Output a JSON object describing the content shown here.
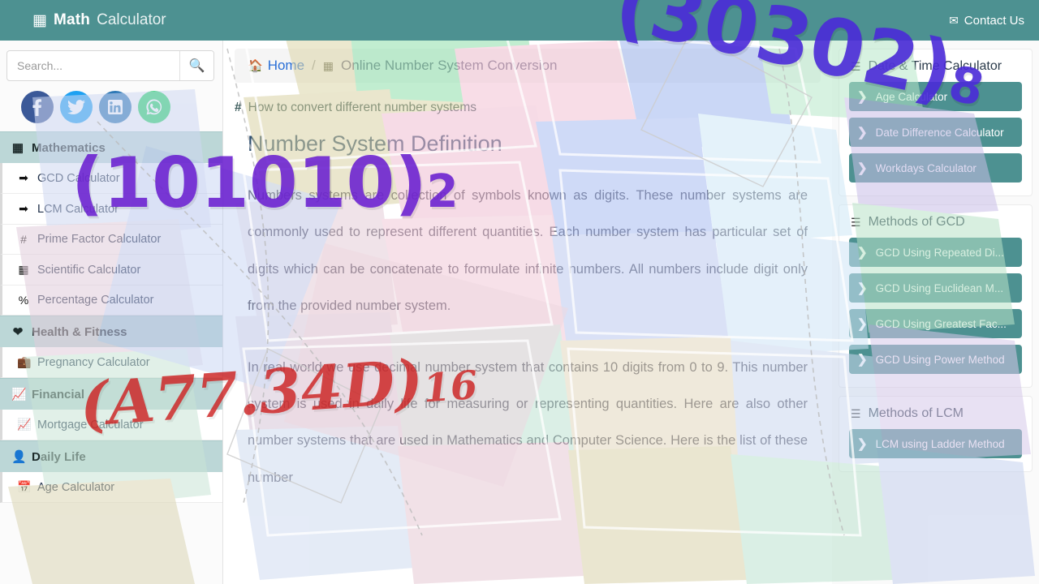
{
  "header": {
    "brand_strong": "Math",
    "brand_light": "Calculator",
    "brand_icon": "calculator-icon",
    "contact_label": "Contact Us",
    "contact_icon": "envelope-icon",
    "bg_color": "#4d9191"
  },
  "search": {
    "placeholder": "Search...",
    "value": "",
    "button_icon": "search-icon"
  },
  "socials": [
    {
      "name": "facebook",
      "label": "f",
      "color": "#3b5998"
    },
    {
      "name": "twitter",
      "label": "t",
      "color": "#1da1f2"
    },
    {
      "name": "linkedin",
      "label": "in",
      "color": "#2b77b5"
    },
    {
      "name": "whatsapp",
      "label": "w",
      "color": "#25d366"
    }
  ],
  "sidebar": {
    "groups": [
      {
        "label": "Mathematics",
        "icon": "calculator-icon",
        "items": [
          {
            "label": "GCD Calculator",
            "icon": "arrow-in-box-icon"
          },
          {
            "label": "LCM Calculator",
            "icon": "arrow-in-box-icon"
          },
          {
            "label": "Prime Factor Calculator",
            "icon": "hash-icon"
          },
          {
            "label": "Scientific Calculator",
            "icon": "calculator-icon"
          },
          {
            "label": "Percentage Calculator",
            "icon": "percent-icon"
          }
        ]
      },
      {
        "label": "Health & Fitness",
        "icon": "heartbeat-icon",
        "items": [
          {
            "label": "Pregnancy Calculator",
            "icon": "briefcase-medical-icon"
          }
        ]
      },
      {
        "label": "Financial",
        "icon": "chart-line-icon",
        "items": [
          {
            "label": "Mortgage Calculator",
            "icon": "chart-line-icon"
          }
        ]
      },
      {
        "label": "Daily Life",
        "icon": "user-icon",
        "items": [
          {
            "label": "Age Calculator",
            "icon": "calendar-icon"
          }
        ]
      }
    ]
  },
  "breadcrumb": {
    "home": "Home",
    "home_icon": "home-icon",
    "separator": "/",
    "current_icon": "memory-chip-icon",
    "current": "Online Number System Conversion"
  },
  "main": {
    "subhead_icon": "hash-icon",
    "subhead": "How to convert different number systems",
    "section_title": "Number System Definition",
    "paragraph_1": "Numbers systems are collection of symbols known as digits. These number systems are commonly used to represent different quantities. Each number system has particular set of digits which can be concatenate to formulate infinite numbers. All numbers include digit only from the provided number system.",
    "paragraph_2": "In real world we use decimal number system that contains 10 digits from 0 to 9. This number system is used in daily life for measuring or representing quantities. Here are also other number systems that are used in Mathematics and Computer Science. Here is the list of these number"
  },
  "rightbar": {
    "cards": [
      {
        "title": "Date & Time Calculator",
        "title_icon": "bars-icon",
        "items": [
          {
            "label": "Age Calculator",
            "icon": "chevron-right-icon"
          },
          {
            "label": "Date Difference Calculator",
            "icon": "chevron-right-icon"
          },
          {
            "label": "Workdays Calculator",
            "icon": "chevron-right-icon"
          }
        ]
      },
      {
        "title": "Methods of GCD",
        "title_icon": "bars-icon",
        "items": [
          {
            "label": "GCD Using Repeated Di...",
            "icon": "chevron-right-icon"
          },
          {
            "label": "GCD Using Euclidean M...",
            "icon": "chevron-right-icon"
          },
          {
            "label": "GCD Using Greatest Fac...",
            "icon": "chevron-right-icon"
          },
          {
            "label": "GCD Using Power Method",
            "icon": "chevron-right-icon"
          }
        ]
      },
      {
        "title": "Methods of LCM",
        "title_icon": "bars-icon",
        "items": [
          {
            "label": "LCM using Ladder Method",
            "icon": "chevron-right-icon"
          }
        ]
      }
    ]
  },
  "annotations": [
    {
      "name": "binary-overlay",
      "main": "(101010)",
      "sub": "2",
      "color": "#6a1fd0"
    },
    {
      "name": "octal-overlay",
      "main": "(30302)",
      "sub": "8",
      "color": "#4a2ad8"
    },
    {
      "name": "hex-overlay",
      "main": "(A77.34D)",
      "sub": "16",
      "color": "#cc2222"
    }
  ]
}
